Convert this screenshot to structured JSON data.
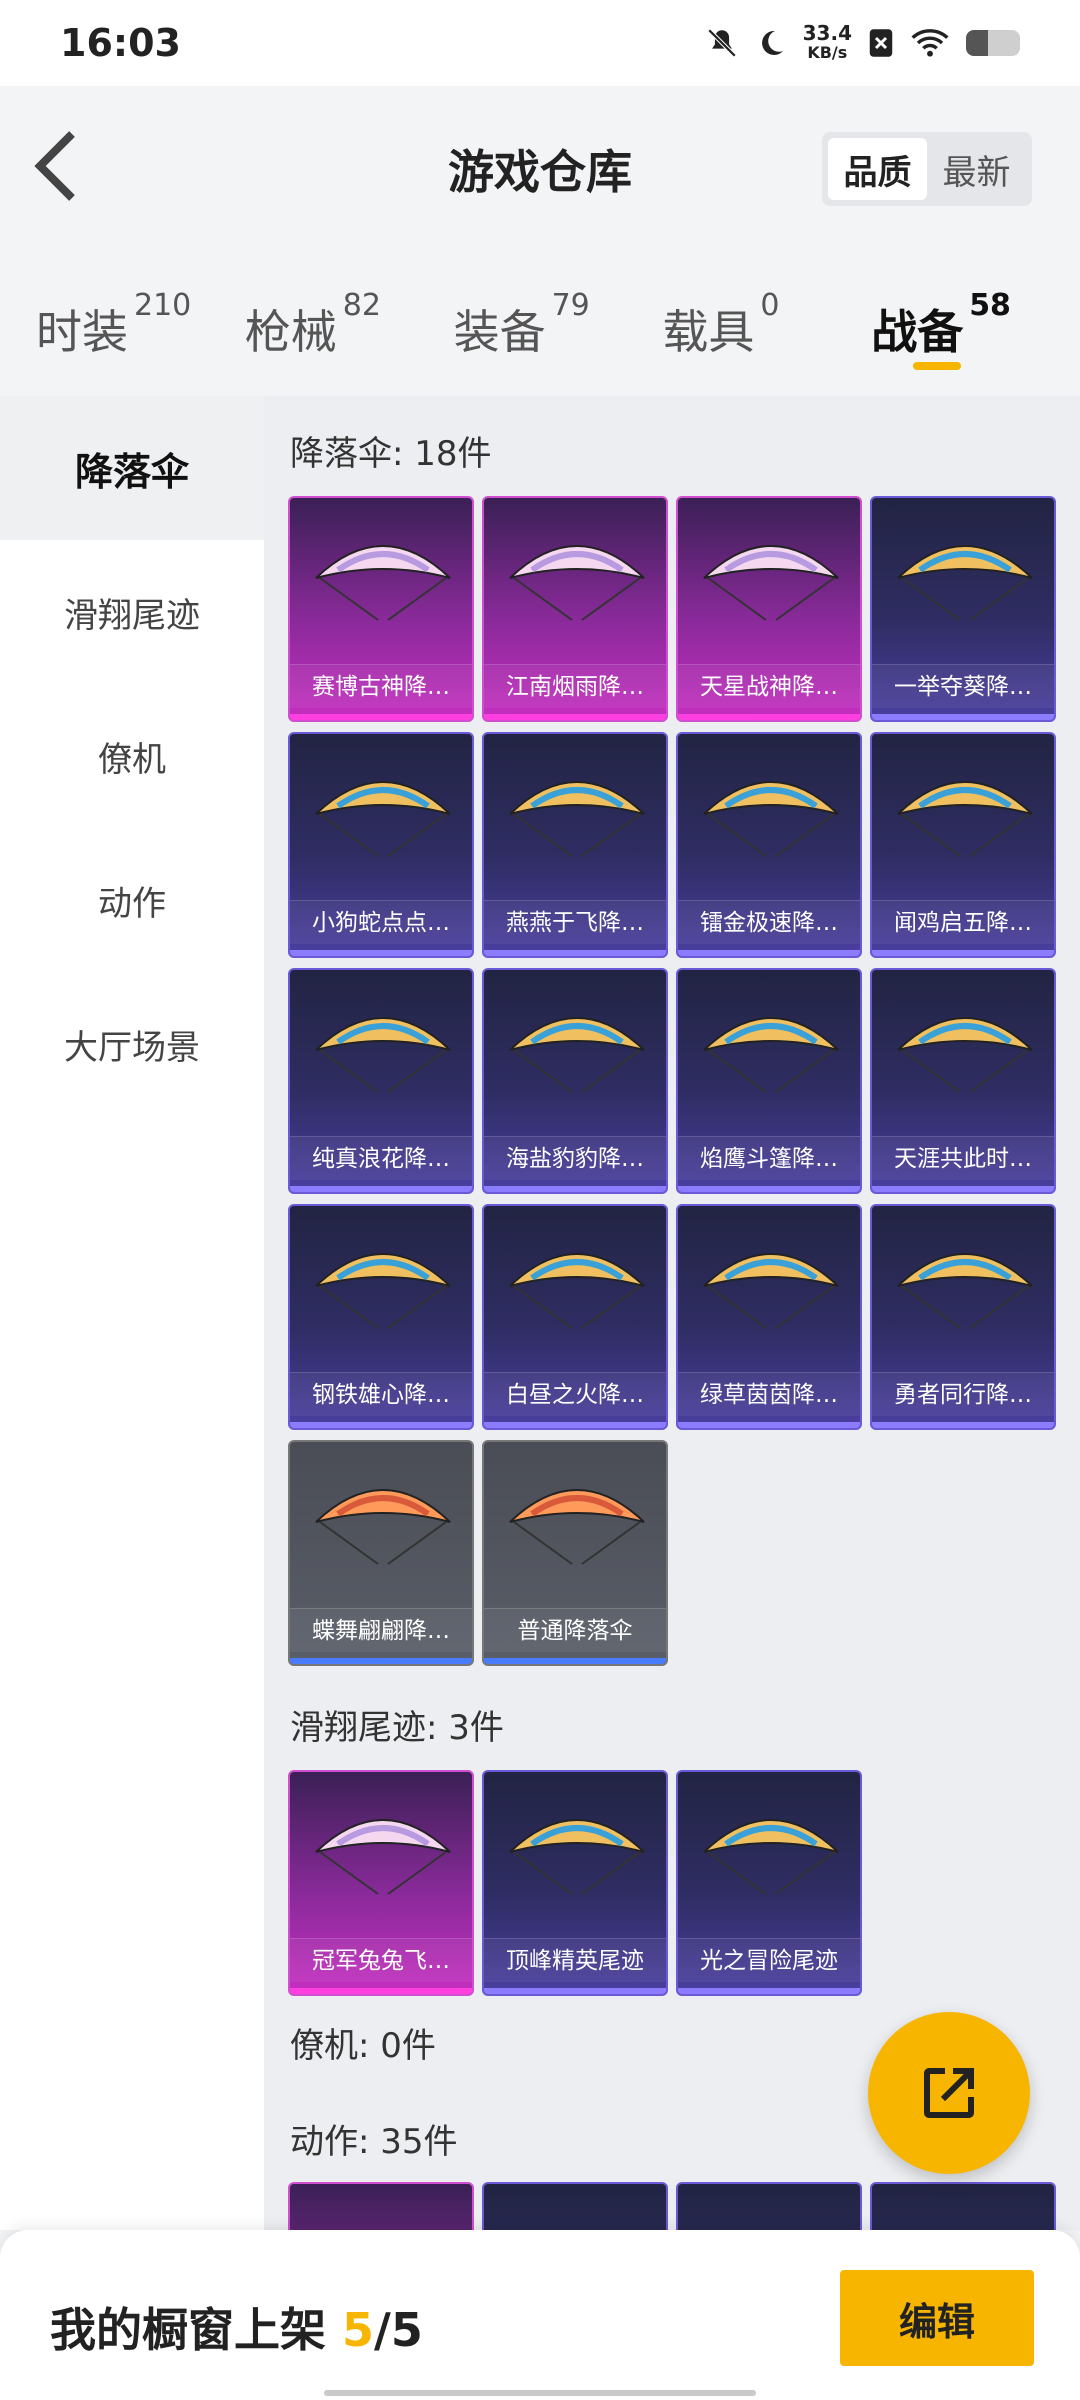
{
  "status_bar": {
    "time": "16:03",
    "net_speed_value": "33.4",
    "net_speed_unit": "KB/s"
  },
  "header": {
    "title": "游戏仓库",
    "sort_options": [
      "品质",
      "最新"
    ],
    "sort_selected": "品质"
  },
  "tabs": [
    {
      "label": "时装",
      "count": "210"
    },
    {
      "label": "枪械",
      "count": "82"
    },
    {
      "label": "装备",
      "count": "79"
    },
    {
      "label": "载具",
      "count": "0"
    },
    {
      "label": "战备",
      "count": "58",
      "active": true
    }
  ],
  "sidebar": {
    "items": [
      "降落伞",
      "滑翔尾迹",
      "僚机",
      "动作",
      "大厅场景"
    ],
    "active": "降落伞"
  },
  "sections": {
    "parachute": {
      "title": "降落伞: 18件",
      "items": [
        {
          "name": "赛博古神降…",
          "rarity": "pink"
        },
        {
          "name": "江南烟雨降…",
          "rarity": "pink"
        },
        {
          "name": "天星战神降…",
          "rarity": "pink"
        },
        {
          "name": "一举夺葵降…",
          "rarity": "blue"
        },
        {
          "name": "小狗蛇点点…",
          "rarity": "blue"
        },
        {
          "name": "燕燕于飞降…",
          "rarity": "blue"
        },
        {
          "name": "镭金极速降…",
          "rarity": "blue"
        },
        {
          "name": "闻鸡启五降…",
          "rarity": "blue"
        },
        {
          "name": "纯真浪花降…",
          "rarity": "blue"
        },
        {
          "name": "海盐豹豹降…",
          "rarity": "blue"
        },
        {
          "name": "焰鹰斗篷降…",
          "rarity": "blue"
        },
        {
          "name": "天涯共此时…",
          "rarity": "blue"
        },
        {
          "name": "钢铁雄心降…",
          "rarity": "blue"
        },
        {
          "name": "白昼之火降…",
          "rarity": "blue"
        },
        {
          "name": "绿草茵茵降…",
          "rarity": "blue"
        },
        {
          "name": "勇者同行降…",
          "rarity": "blue"
        },
        {
          "name": "蝶舞翩翩降…",
          "rarity": "gray"
        },
        {
          "name": "普通降落伞",
          "rarity": "gray"
        }
      ]
    },
    "glide_trail": {
      "title": "滑翔尾迹: 3件",
      "items": [
        {
          "name": "冠军兔兔飞…",
          "rarity": "pink"
        },
        {
          "name": "顶峰精英尾迹",
          "rarity": "blue"
        },
        {
          "name": "光之冒险尾迹",
          "rarity": "blue"
        }
      ]
    },
    "wingman": {
      "title": "僚机: 0件"
    },
    "emote": {
      "title": "动作: 35件"
    }
  },
  "bottom_bar": {
    "label": "我的橱窗上架",
    "current": "5",
    "separator": "/",
    "total": "5",
    "edit_label": "编辑"
  },
  "colors": {
    "accent": "#f7b500",
    "pink_rarity": "#c52fc0",
    "blue_rarity": "#4a3fa0"
  },
  "icons": {
    "back": "chevron-left-icon",
    "share": "share-external-icon"
  }
}
